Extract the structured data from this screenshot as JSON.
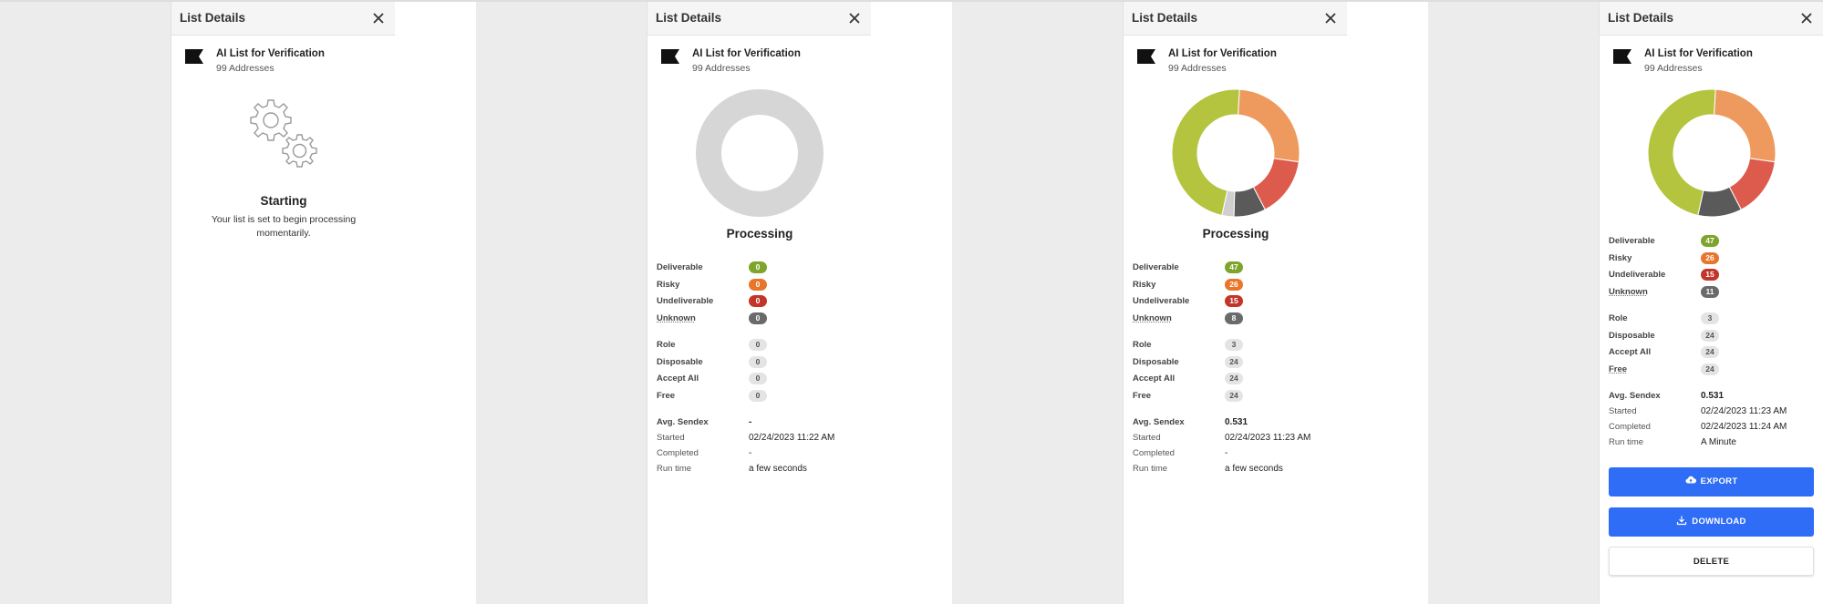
{
  "panels": [
    {
      "title": "List Details",
      "list_name": "AI List for Verification",
      "list_count": "99 Addresses",
      "state": "Starting",
      "message": "Your list is set to begin processing momentarily."
    },
    {
      "title": "List Details",
      "list_name": "AI List for Verification",
      "list_count": "99 Addresses",
      "state": "Processing",
      "results": {
        "deliverable": {
          "label": "Deliverable",
          "value": "0"
        },
        "risky": {
          "label": "Risky",
          "value": "0"
        },
        "undeliverable": {
          "label": "Undeliverable",
          "value": "0"
        },
        "unknown": {
          "label": "Unknown",
          "value": "0"
        }
      },
      "flags": {
        "role": {
          "label": "Role",
          "value": "0"
        },
        "disposable": {
          "label": "Disposable",
          "value": "0"
        },
        "accept_all": {
          "label": "Accept All",
          "value": "0"
        },
        "free": {
          "label": "Free",
          "value": "0"
        }
      },
      "info": {
        "avg_sendex": {
          "label": "Avg. Sendex",
          "value": "-"
        },
        "started": {
          "label": "Started",
          "value": "02/24/2023 11:22 AM"
        },
        "completed": {
          "label": "Completed",
          "value": "-"
        },
        "run_time": {
          "label": "Run time",
          "value": "a few seconds"
        }
      }
    },
    {
      "title": "List Details",
      "list_name": "AI List for Verification",
      "list_count": "99 Addresses",
      "state": "Processing",
      "results": {
        "deliverable": {
          "label": "Deliverable",
          "value": "47"
        },
        "risky": {
          "label": "Risky",
          "value": "26"
        },
        "undeliverable": {
          "label": "Undeliverable",
          "value": "15"
        },
        "unknown": {
          "label": "Unknown",
          "value": "8"
        }
      },
      "flags": {
        "role": {
          "label": "Role",
          "value": "3"
        },
        "disposable": {
          "label": "Disposable",
          "value": "24"
        },
        "accept_all": {
          "label": "Accept All",
          "value": "24"
        },
        "free": {
          "label": "Free",
          "value": "24"
        }
      },
      "info": {
        "avg_sendex": {
          "label": "Avg. Sendex",
          "value": "0.531"
        },
        "started": {
          "label": "Started",
          "value": "02/24/2023 11:23 AM"
        },
        "completed": {
          "label": "Completed",
          "value": "-"
        },
        "run_time": {
          "label": "Run time",
          "value": "a few seconds"
        }
      }
    },
    {
      "title": "List Details",
      "list_name": "AI List for Verification",
      "list_count": "99 Addresses",
      "results": {
        "deliverable": {
          "label": "Deliverable",
          "value": "47"
        },
        "risky": {
          "label": "Risky",
          "value": "26"
        },
        "undeliverable": {
          "label": "Undeliverable",
          "value": "15"
        },
        "unknown": {
          "label": "Unknown",
          "value": "11"
        }
      },
      "flags": {
        "role": {
          "label": "Role",
          "value": "3"
        },
        "disposable": {
          "label": "Disposable",
          "value": "24"
        },
        "accept_all": {
          "label": "Accept All",
          "value": "24"
        },
        "free": {
          "label": "Free",
          "value": "24"
        }
      },
      "info": {
        "avg_sendex": {
          "label": "Avg. Sendex",
          "value": "0.531"
        },
        "started": {
          "label": "Started",
          "value": "02/24/2023 11:23 AM"
        },
        "completed": {
          "label": "Completed",
          "value": "02/24/2023 11:24 AM"
        },
        "run_time": {
          "label": "Run time",
          "value": "A Minute"
        }
      },
      "buttons": {
        "export": "EXPORT",
        "download": "DOWNLOAD",
        "delete": "DELETE"
      }
    }
  ],
  "icons": {
    "close": "close-icon",
    "flag": "flag-icon",
    "gears": "gears-icon",
    "cloud_upload": "cloud-upload-icon",
    "download": "download-icon"
  },
  "colors": {
    "deliverable": "#b5c43e",
    "risky": "#ee9a5e",
    "undeliverable": "#dd5b4c",
    "unknown": "#5a5a5a",
    "empty": "#d6d6d6",
    "accent": "#2f6df6"
  },
  "donuts": [
    null,
    {
      "segments": [
        {
          "key": "empty",
          "value": 1
        }
      ]
    },
    {
      "segments": [
        {
          "key": "risky",
          "value": 26
        },
        {
          "key": "undeliverable",
          "value": 15
        },
        {
          "key": "unknown",
          "value": 8
        },
        {
          "key": "pending",
          "value": 3
        },
        {
          "key": "deliverable",
          "value": 47
        }
      ]
    },
    {
      "segments": [
        {
          "key": "risky",
          "value": 26
        },
        {
          "key": "undeliverable",
          "value": 15
        },
        {
          "key": "unknown",
          "value": 11
        },
        {
          "key": "deliverable",
          "value": 47
        }
      ]
    }
  ]
}
